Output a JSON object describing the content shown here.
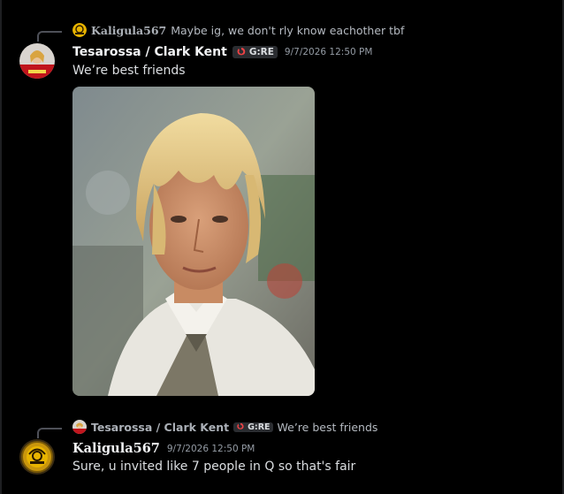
{
  "message1": {
    "reply": {
      "author": "Kaligula567",
      "text": "Maybe ig, we don't rly know eachother tbf"
    },
    "author": "Tesarossa / Clark Kent",
    "tag": "G:RE",
    "timestamp": "9/7/2026 12:50 PM",
    "text": "We’re best friends"
  },
  "message2": {
    "reply": {
      "author": "Tesarossa / Clark Kent",
      "tag": "G:RE",
      "text": "We’re best friends"
    },
    "author": "Kaligula567",
    "timestamp": "9/7/2026 12:50 PM",
    "text": "Sure, u invited like 7 people in Q so that's fair"
  },
  "colors": {
    "background": "#000000",
    "username": "#f2f3f5",
    "muted": "#949ba4",
    "tag_bg": "#2b2d31",
    "tag_icon": "#ed4245"
  }
}
